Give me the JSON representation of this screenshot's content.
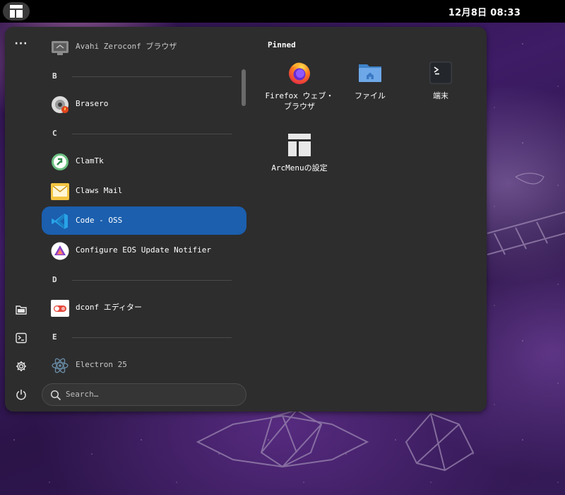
{
  "topbar": {
    "clock": "12月8日  08:33"
  },
  "side_rail": {
    "more_label": "···"
  },
  "app_list": {
    "items": [
      {
        "kind": "app",
        "label": "Avahi Zeroconf ブラウザ",
        "icon": "network-monitor-icon"
      },
      {
        "kind": "section",
        "label": "B"
      },
      {
        "kind": "app",
        "label": "Brasero",
        "icon": "disc-burner-icon"
      },
      {
        "kind": "section",
        "label": "C"
      },
      {
        "kind": "app",
        "label": "ClamTk",
        "icon": "antivirus-icon"
      },
      {
        "kind": "app",
        "label": "Claws Mail",
        "icon": "mail-icon"
      },
      {
        "kind": "app",
        "label": "Code - OSS",
        "icon": "code-editor-icon",
        "selected": true
      },
      {
        "kind": "app",
        "label": "Configure EOS Update Notifier",
        "icon": "update-notifier-icon"
      },
      {
        "kind": "section",
        "label": "D"
      },
      {
        "kind": "app",
        "label": "dconf エディター",
        "icon": "toggle-switch-icon"
      },
      {
        "kind": "section",
        "label": "E"
      },
      {
        "kind": "app",
        "label": "Electron 25",
        "icon": "electron-atom-icon"
      }
    ]
  },
  "search": {
    "placeholder": "Search…"
  },
  "pinned": {
    "title": "Pinned",
    "items": [
      {
        "label": "Firefox ウェブ・ブラウザ",
        "icon": "firefox-icon"
      },
      {
        "label": "ファイル",
        "icon": "files-folder-icon"
      },
      {
        "label": "端末",
        "icon": "terminal-icon"
      },
      {
        "label": "ArcMenuの設定",
        "icon": "arcmenu-settings-icon"
      }
    ]
  },
  "colors": {
    "accent": "#1b5fae",
    "panel": "#2d2d2e",
    "topbar": "#000000"
  }
}
